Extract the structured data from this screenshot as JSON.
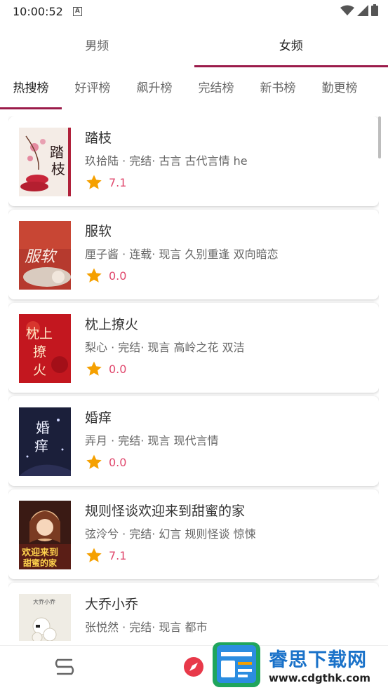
{
  "status_bar": {
    "time": "10:00:52",
    "indicator": "A"
  },
  "top_tabs": [
    {
      "label": "男频",
      "active": false
    },
    {
      "label": "女频",
      "active": true
    }
  ],
  "sub_tabs": [
    {
      "label": "热搜榜",
      "active": true
    },
    {
      "label": "好评榜",
      "active": false
    },
    {
      "label": "飙升榜",
      "active": false
    },
    {
      "label": "完结榜",
      "active": false
    },
    {
      "label": "新书榜",
      "active": false
    },
    {
      "label": "勤更榜",
      "active": false
    }
  ],
  "books": [
    {
      "title": "踏枝",
      "meta": "玖拾陆 · 完结· 古言 古代言情 he",
      "rating": "7.1"
    },
    {
      "title": "服软",
      "meta": "厘子酱 · 连载· 现言 久别重逢 双向暗恋",
      "rating": "0.0"
    },
    {
      "title": "枕上撩火",
      "meta": "梨心 · 完结· 现言 高岭之花 双洁",
      "rating": "0.0"
    },
    {
      "title": "婚痒",
      "meta": "弄月 · 完结· 现言 现代言情",
      "rating": "0.0"
    },
    {
      "title": "规则怪谈欢迎来到甜蜜的家",
      "meta": "弦泠兮 · 完结· 幻言 规则怪谈 惊悚",
      "rating": "7.1"
    },
    {
      "title": "大乔小乔",
      "meta": "张悦然 · 完结· 现言 都市",
      "rating": ""
    }
  ],
  "covers": {
    "book_1": {
      "art": "踏枝"
    },
    "book_2": {
      "art": "服软"
    },
    "book_3": {
      "art": "枕上撩火"
    },
    "book_4": {
      "art": "婚痒"
    },
    "book_5": {
      "art": "欢迎来到甜蜜的家"
    },
    "book_6": {
      "art": "大乔小乔"
    }
  },
  "icons": {
    "star": "star-icon",
    "bookshelf": "bookshelf-icon",
    "explore": "compass-icon"
  },
  "colors": {
    "accent": "#9b1b4a",
    "rating": "#e0486d",
    "star": "#f5a000"
  },
  "watermark": {
    "title": "睿思下载网",
    "url": "www.cdgthk.com"
  }
}
